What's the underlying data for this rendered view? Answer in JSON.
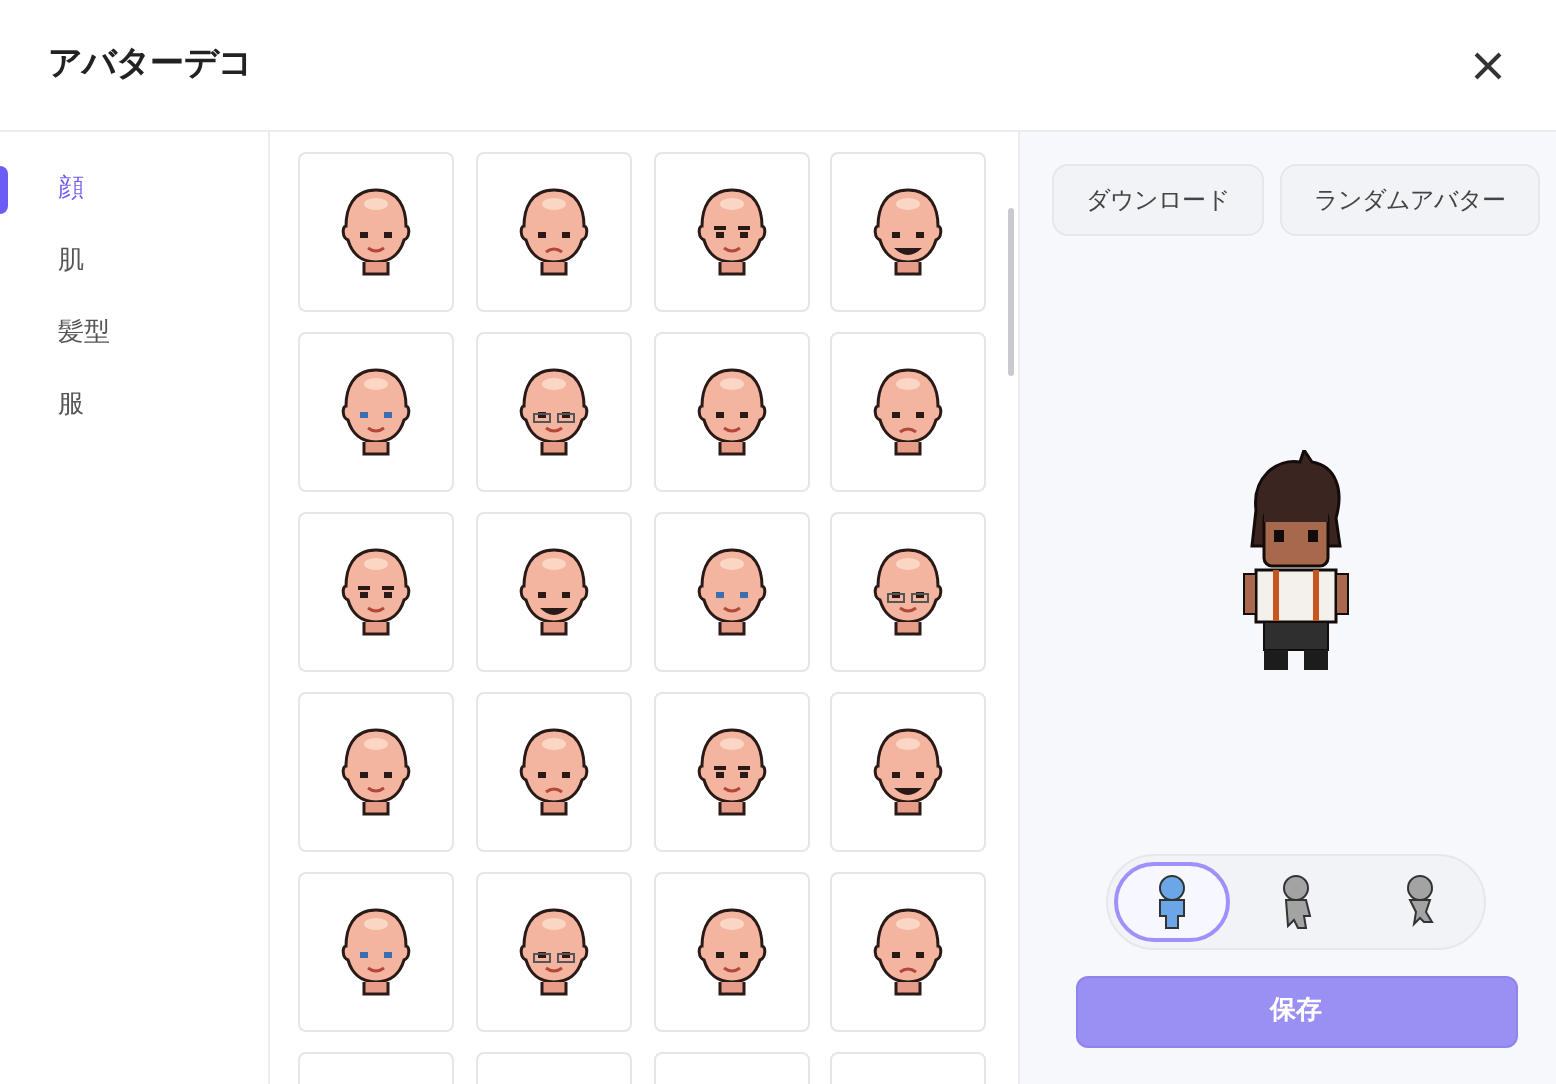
{
  "window": {
    "title": "アバターデコ"
  },
  "categories": [
    {
      "label": "顔",
      "selected": true
    },
    {
      "label": "肌",
      "selected": false
    },
    {
      "label": "髪型",
      "selected": false
    },
    {
      "label": "服",
      "selected": false
    }
  ],
  "actions": [
    "ダウンロード",
    "ランダムアバター"
  ],
  "poses": [
    {
      "selected": true
    },
    {
      "selected": false
    },
    {
      "selected": false
    }
  ],
  "save_button": {
    "label": "保存",
    "disabled": true
  }
}
